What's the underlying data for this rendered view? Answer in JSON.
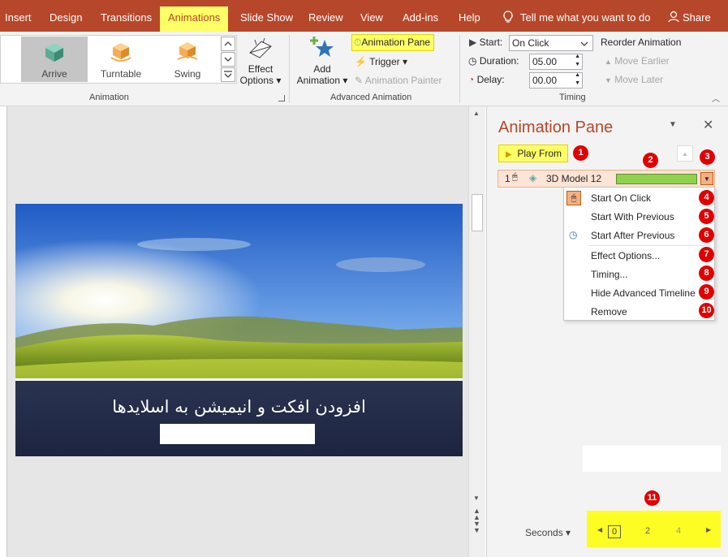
{
  "tabs": [
    "Insert",
    "Design",
    "Transitions",
    "Animations",
    "Slide Show",
    "Review",
    "View",
    "Add-ins",
    "Help"
  ],
  "active_tab": "Animations",
  "tell_me": "Tell me what you want to do",
  "share": "Share",
  "ribbon": {
    "animation_group": {
      "label": "Animation",
      "effects": [
        "Arrive",
        "Turntable",
        "Swing"
      ],
      "effect_options_line1": "Effect",
      "effect_options_line2": "Options"
    },
    "advanced_group": {
      "label": "Advanced Animation",
      "add_animation_line1": "Add",
      "add_animation_line2": "Animation",
      "animation_pane": "Animation Pane",
      "trigger": "Trigger",
      "animation_painter": "Animation Painter"
    },
    "timing_group": {
      "label": "Timing",
      "start_label": "Start:",
      "start_value": "On Click",
      "duration_label": "Duration:",
      "duration_value": "05.00",
      "delay_label": "Delay:",
      "delay_value": "00.00",
      "reorder_title": "Reorder Animation",
      "move_earlier": "Move Earlier",
      "move_later": "Move Later"
    }
  },
  "slide": {
    "caption": "افزودن افکت و انیمیشن به اسلایدها"
  },
  "pane": {
    "title": "Animation Pane",
    "play_from": "Play From",
    "item_number": "1",
    "item_name": "3D Model 12",
    "menu": [
      {
        "label": "Start On Click",
        "badge": "4"
      },
      {
        "label": "Start With Previous",
        "badge": "5"
      },
      {
        "label": "Start After Previous",
        "badge": "6"
      },
      {
        "label": "Effect Options...",
        "badge": "7"
      },
      {
        "label": "Timing...",
        "badge": "8"
      },
      {
        "label": "Hide Advanced Timeline",
        "badge": "9"
      },
      {
        "label": "Remove",
        "badge": "10"
      }
    ],
    "badges": {
      "play": "1",
      "bar": "2",
      "up": "3",
      "timeline": "11"
    },
    "seconds": "Seconds",
    "timeline_ticks": [
      "0",
      "2",
      "4"
    ]
  },
  "colors": {
    "accent": "#b7472a",
    "highlight": "#ffff66",
    "badge": "#e00000",
    "bar": "#92d050"
  }
}
